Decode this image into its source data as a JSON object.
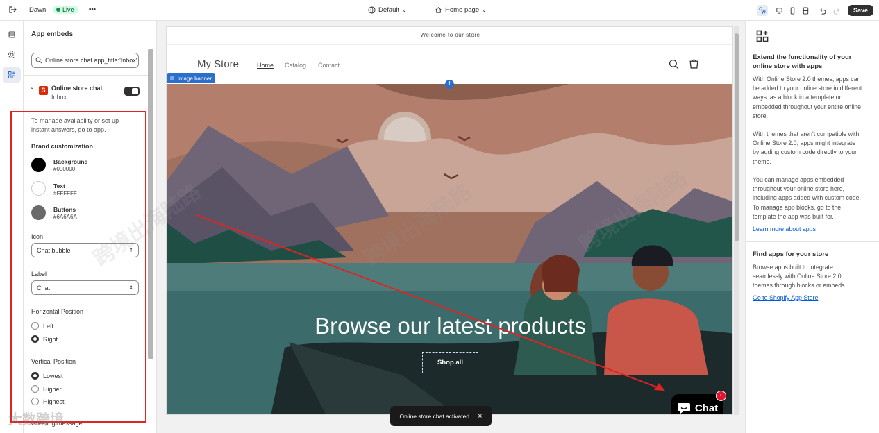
{
  "topbar": {
    "theme_name": "Dawn",
    "live_label": "Live",
    "more_label": "•••",
    "default_label": "Default",
    "page_label": "Home page",
    "save_label": "Save"
  },
  "left": {
    "title": "App embeds",
    "search_value": "Online store chat app_title:'Inbox'",
    "app_name": "Online store chat",
    "app_sub": "Inbox",
    "app_icon_letter": "S",
    "intro": "To manage availability or set up instant answers, go to app.",
    "brand_heading": "Brand customization",
    "swatches": [
      {
        "label": "Background",
        "value": "#000000",
        "color": "#000000"
      },
      {
        "label": "Text",
        "value": "#FFFFFF",
        "color": "#ffffff"
      },
      {
        "label": "Buttons",
        "value": "#6A6A6A",
        "color": "#6a6a6a"
      }
    ],
    "icon_label": "Icon",
    "icon_value": "Chat bubble",
    "label_label": "Label",
    "label_value": "Chat",
    "hpos_label": "Horizontal Position",
    "hpos_options": [
      "Left",
      "Right"
    ],
    "hpos_selected": "Right",
    "vpos_label": "Vertical Position",
    "vpos_options": [
      "Lowest",
      "Higher",
      "Highest"
    ],
    "vpos_selected": "Lowest",
    "greeting_label": "Greeting message"
  },
  "preview": {
    "announcement": "Welcome to our store",
    "store_name": "My Store",
    "nav": [
      "Home",
      "Catalog",
      "Contact"
    ],
    "block_label": "Image banner",
    "hero_title": "Browse our latest products",
    "hero_button": "Shop all",
    "chat_label": "Chat",
    "chat_badge": "1",
    "toast": "Online store chat activated",
    "toast_close": "×"
  },
  "right": {
    "h1": "Extend the functionality of your online store with apps",
    "p1": "With Online Store 2.0 themes, apps can be added to your online store in different ways: as a block in a template or embedded throughout your entire online store.",
    "p2": "With themes that aren't compatible with Online Store 2.0, apps might integrate by adding custom code directly to your theme.",
    "p3": "You can manage apps embedded throughout your online store here, including apps added with custom code. To manage app blocks, go to the template the app was built for.",
    "link1": "Learn more about apps",
    "h2": "Find apps for your store",
    "p4": "Browse apps built to integrate seamlessly with Online Store 2.0 themes through blocks or embeds.",
    "link2": "Go to Shopify App Store"
  },
  "watermark": {
    "text": "跨境出海陆路",
    "logo_text": "大数跨境"
  }
}
